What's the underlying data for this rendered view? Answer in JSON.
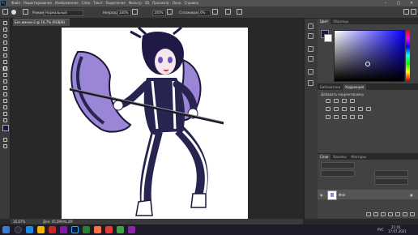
{
  "menubar": {
    "app_badge": "Ps",
    "items": [
      "Файл",
      "Редактирование",
      "Изображение",
      "Слои",
      "Текст",
      "Выделение",
      "Фильтр",
      "3D",
      "Просмотр",
      "Окно",
      "Справка"
    ],
    "window_controls": [
      "–",
      "▢",
      "✕"
    ]
  },
  "options": {
    "mode_label": "Режим:",
    "mode_value": "Нормальный",
    "opacity_label": "Непрозр.:",
    "opacity_value": "100%",
    "pressure_value": "100%",
    "smoothing_label": "Сглаживание:",
    "smoothing_value": "0%"
  },
  "document": {
    "tab_title": "Без имени-2 @ 16,7% (RGB/8)",
    "zoom": "16,67%",
    "doc_info": "Док: 45,6M/94,2M"
  },
  "color_panel": {
    "tabs": [
      "Цвет",
      "Образцы"
    ],
    "foreground": "#1c1749",
    "background": "#ffffff",
    "hue_color": "#0a00ff"
  },
  "lib_panel": {
    "tabs": [
      "Библиотеки",
      "Коррекция"
    ],
    "add_label": "Добавить корректировку"
  },
  "layers_panel": {
    "tabs": [
      "Слои",
      "Каналы",
      "Контуры"
    ],
    "layer_name": "Фон"
  },
  "taskbar": {
    "lang": "РУС",
    "time": "21:01",
    "date": "17.07.2021"
  },
  "colors": {
    "purple_light": "#9b85d6",
    "purple_dark": "#27244f",
    "accent_blue": "#31a8ff"
  }
}
